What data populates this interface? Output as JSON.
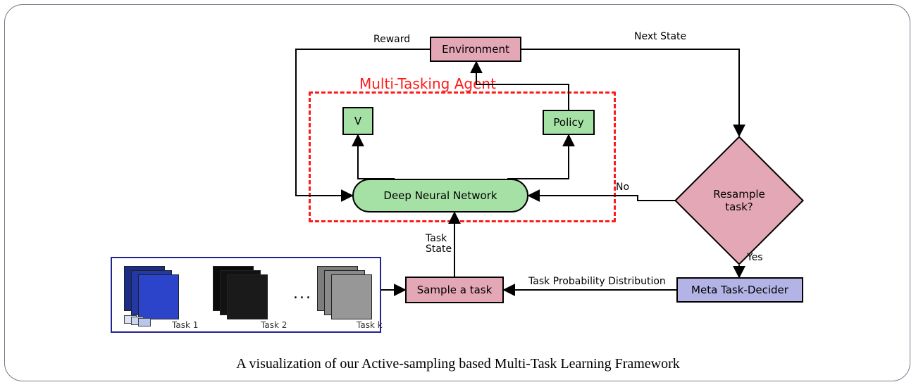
{
  "nodes": {
    "environment": "Environment",
    "v": "V",
    "policy": "Policy",
    "dnn": "Deep Neural Network",
    "sample": "Sample a task",
    "decider": "Meta Task-Decider",
    "resample": "Resample\ntask?",
    "agent_region": "Multi-Tasking Agent"
  },
  "edge_labels": {
    "reward": "Reward",
    "next_state": "Next State",
    "no": "No",
    "yes": "Yes",
    "task_state": "Task\nState",
    "distribution": "Task Probability Distribution"
  },
  "tasks": {
    "t1": "Task 1",
    "t2": "Task 2",
    "tk": "Task k",
    "ellipsis": "..."
  },
  "caption": "A visualization of our Active-sampling based Multi-Task Learning Framework",
  "colors": {
    "pink": "#e4a7b6",
    "green": "#a5e0a5",
    "lavender": "#b3b3e6",
    "red": "#ff1a1a"
  }
}
